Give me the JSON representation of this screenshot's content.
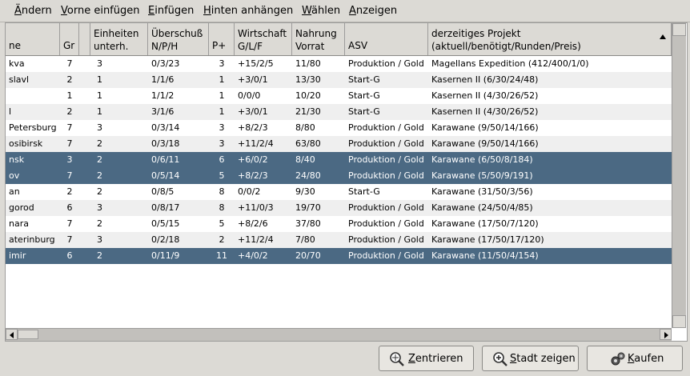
{
  "menu": [
    {
      "label": "Ändern",
      "u": "Ä",
      "rest": "ndern"
    },
    {
      "label": "Vorne einfügen",
      "u": "V",
      "rest": "orne einfügen"
    },
    {
      "label": "Einfügen",
      "u": "E",
      "rest": "infügen"
    },
    {
      "label": "Hinten anhängen",
      "u": "H",
      "rest": "inten anhängen"
    },
    {
      "label": "Wählen",
      "u": "W",
      "rest": "ählen"
    },
    {
      "label": "Anzeigen",
      "u": "A",
      "rest": "nzeigen"
    }
  ],
  "columns": [
    {
      "l1": "",
      "l2": "ne"
    },
    {
      "l1": "",
      "l2": "Gr"
    },
    {
      "l1": "",
      "l2": ""
    },
    {
      "l1": "Einheiten",
      "l2": "unterh."
    },
    {
      "l1": "Überschuß",
      "l2": "N/P/H"
    },
    {
      "l1": "",
      "l2": "P+"
    },
    {
      "l1": "Wirtschaft",
      "l2": "G/L/F"
    },
    {
      "l1": "Nahrung",
      "l2": "Vorrat"
    },
    {
      "l1": "",
      "l2": "ASV"
    },
    {
      "l1": "derzeitiges Projekt",
      "l2": "(aktuell/benötigt/Runden/Preis)"
    }
  ],
  "rows": [
    {
      "name": "kva",
      "gr": "7",
      "units": "3",
      "surplus": "0/3/23",
      "pplus": "3",
      "econ": "+15/2/5",
      "food": "11/80",
      "asv": "Produktion / Gold",
      "project": "Magellans Expedition (412/400/1/0)",
      "selected": false
    },
    {
      "name": "slavl",
      "gr": "2",
      "units": "1",
      "surplus": "1/1/6",
      "pplus": "1",
      "econ": "+3/0/1",
      "food": "13/30",
      "asv": "Start-G",
      "project": "Kasernen II (6/30/24/48)",
      "selected": false
    },
    {
      "name": "",
      "gr": "1",
      "units": "1",
      "surplus": "1/1/2",
      "pplus": "1",
      "econ": "0/0/0",
      "food": "10/20",
      "asv": "Start-G",
      "project": "Kasernen II (4/30/26/52)",
      "selected": false
    },
    {
      "name": "l",
      "gr": "2",
      "units": "1",
      "surplus": "3/1/6",
      "pplus": "1",
      "econ": "+3/0/1",
      "food": "21/30",
      "asv": "Start-G",
      "project": "Kasernen II (4/30/26/52)",
      "selected": false
    },
    {
      "name": "Petersburg",
      "gr": "7",
      "units": "3",
      "surplus": "0/3/14",
      "pplus": "3",
      "econ": "+8/2/3",
      "food": "8/80",
      "asv": "Produktion / Gold",
      "project": "Karawane (9/50/14/166)",
      "selected": false
    },
    {
      "name": "osibirsk",
      "gr": "7",
      "units": "2",
      "surplus": "0/3/18",
      "pplus": "3",
      "econ": "+11/2/4",
      "food": "63/80",
      "asv": "Produktion / Gold",
      "project": "Karawane (9/50/14/166)",
      "selected": false
    },
    {
      "name": "nsk",
      "gr": "3",
      "units": "2",
      "surplus": "0/6/11",
      "pplus": "6",
      "econ": "+6/0/2",
      "food": "8/40",
      "asv": "Produktion / Gold",
      "project": "Karawane (6/50/8/184)",
      "selected": true
    },
    {
      "name": "ov",
      "gr": "7",
      "units": "2",
      "surplus": "0/5/14",
      "pplus": "5",
      "econ": "+8/2/3",
      "food": "24/80",
      "asv": "Produktion / Gold",
      "project": "Karawane (5/50/9/191)",
      "selected": true
    },
    {
      "name": "an",
      "gr": "2",
      "units": "2",
      "surplus": "0/8/5",
      "pplus": "8",
      "econ": "0/0/2",
      "food": "9/30",
      "asv": "Start-G",
      "project": "Karawane (31/50/3/56)",
      "selected": false
    },
    {
      "name": "gorod",
      "gr": "6",
      "units": "3",
      "surplus": "0/8/17",
      "pplus": "8",
      "econ": "+11/0/3",
      "food": "19/70",
      "asv": "Produktion / Gold",
      "project": "Karawane (24/50/4/85)",
      "selected": false
    },
    {
      "name": "nara",
      "gr": "7",
      "units": "2",
      "surplus": "0/5/15",
      "pplus": "5",
      "econ": "+8/2/6",
      "food": "37/80",
      "asv": "Produktion / Gold",
      "project": "Karawane (17/50/7/120)",
      "selected": false
    },
    {
      "name": "aterinburg",
      "gr": "7",
      "units": "3",
      "surplus": "0/2/18",
      "pplus": "2",
      "econ": "+11/2/4",
      "food": "7/80",
      "asv": "Produktion / Gold",
      "project": "Karawane (17/50/17/120)",
      "selected": false
    },
    {
      "name": "imir",
      "gr": "6",
      "units": "2",
      "surplus": "0/11/9",
      "pplus": "11",
      "econ": "+4/0/2",
      "food": "20/70",
      "asv": "Produktion / Gold",
      "project": "Karawane (11/50/4/154)",
      "selected": true
    }
  ],
  "buttons": {
    "center": {
      "u": "Z",
      "rest": "entrieren"
    },
    "show": {
      "u": "S",
      "rest": "tadt zeigen"
    },
    "buy": {
      "u": "K",
      "rest": "aufen"
    }
  },
  "colors": {
    "selection": "#4b6983",
    "stripe": "#efefef"
  }
}
